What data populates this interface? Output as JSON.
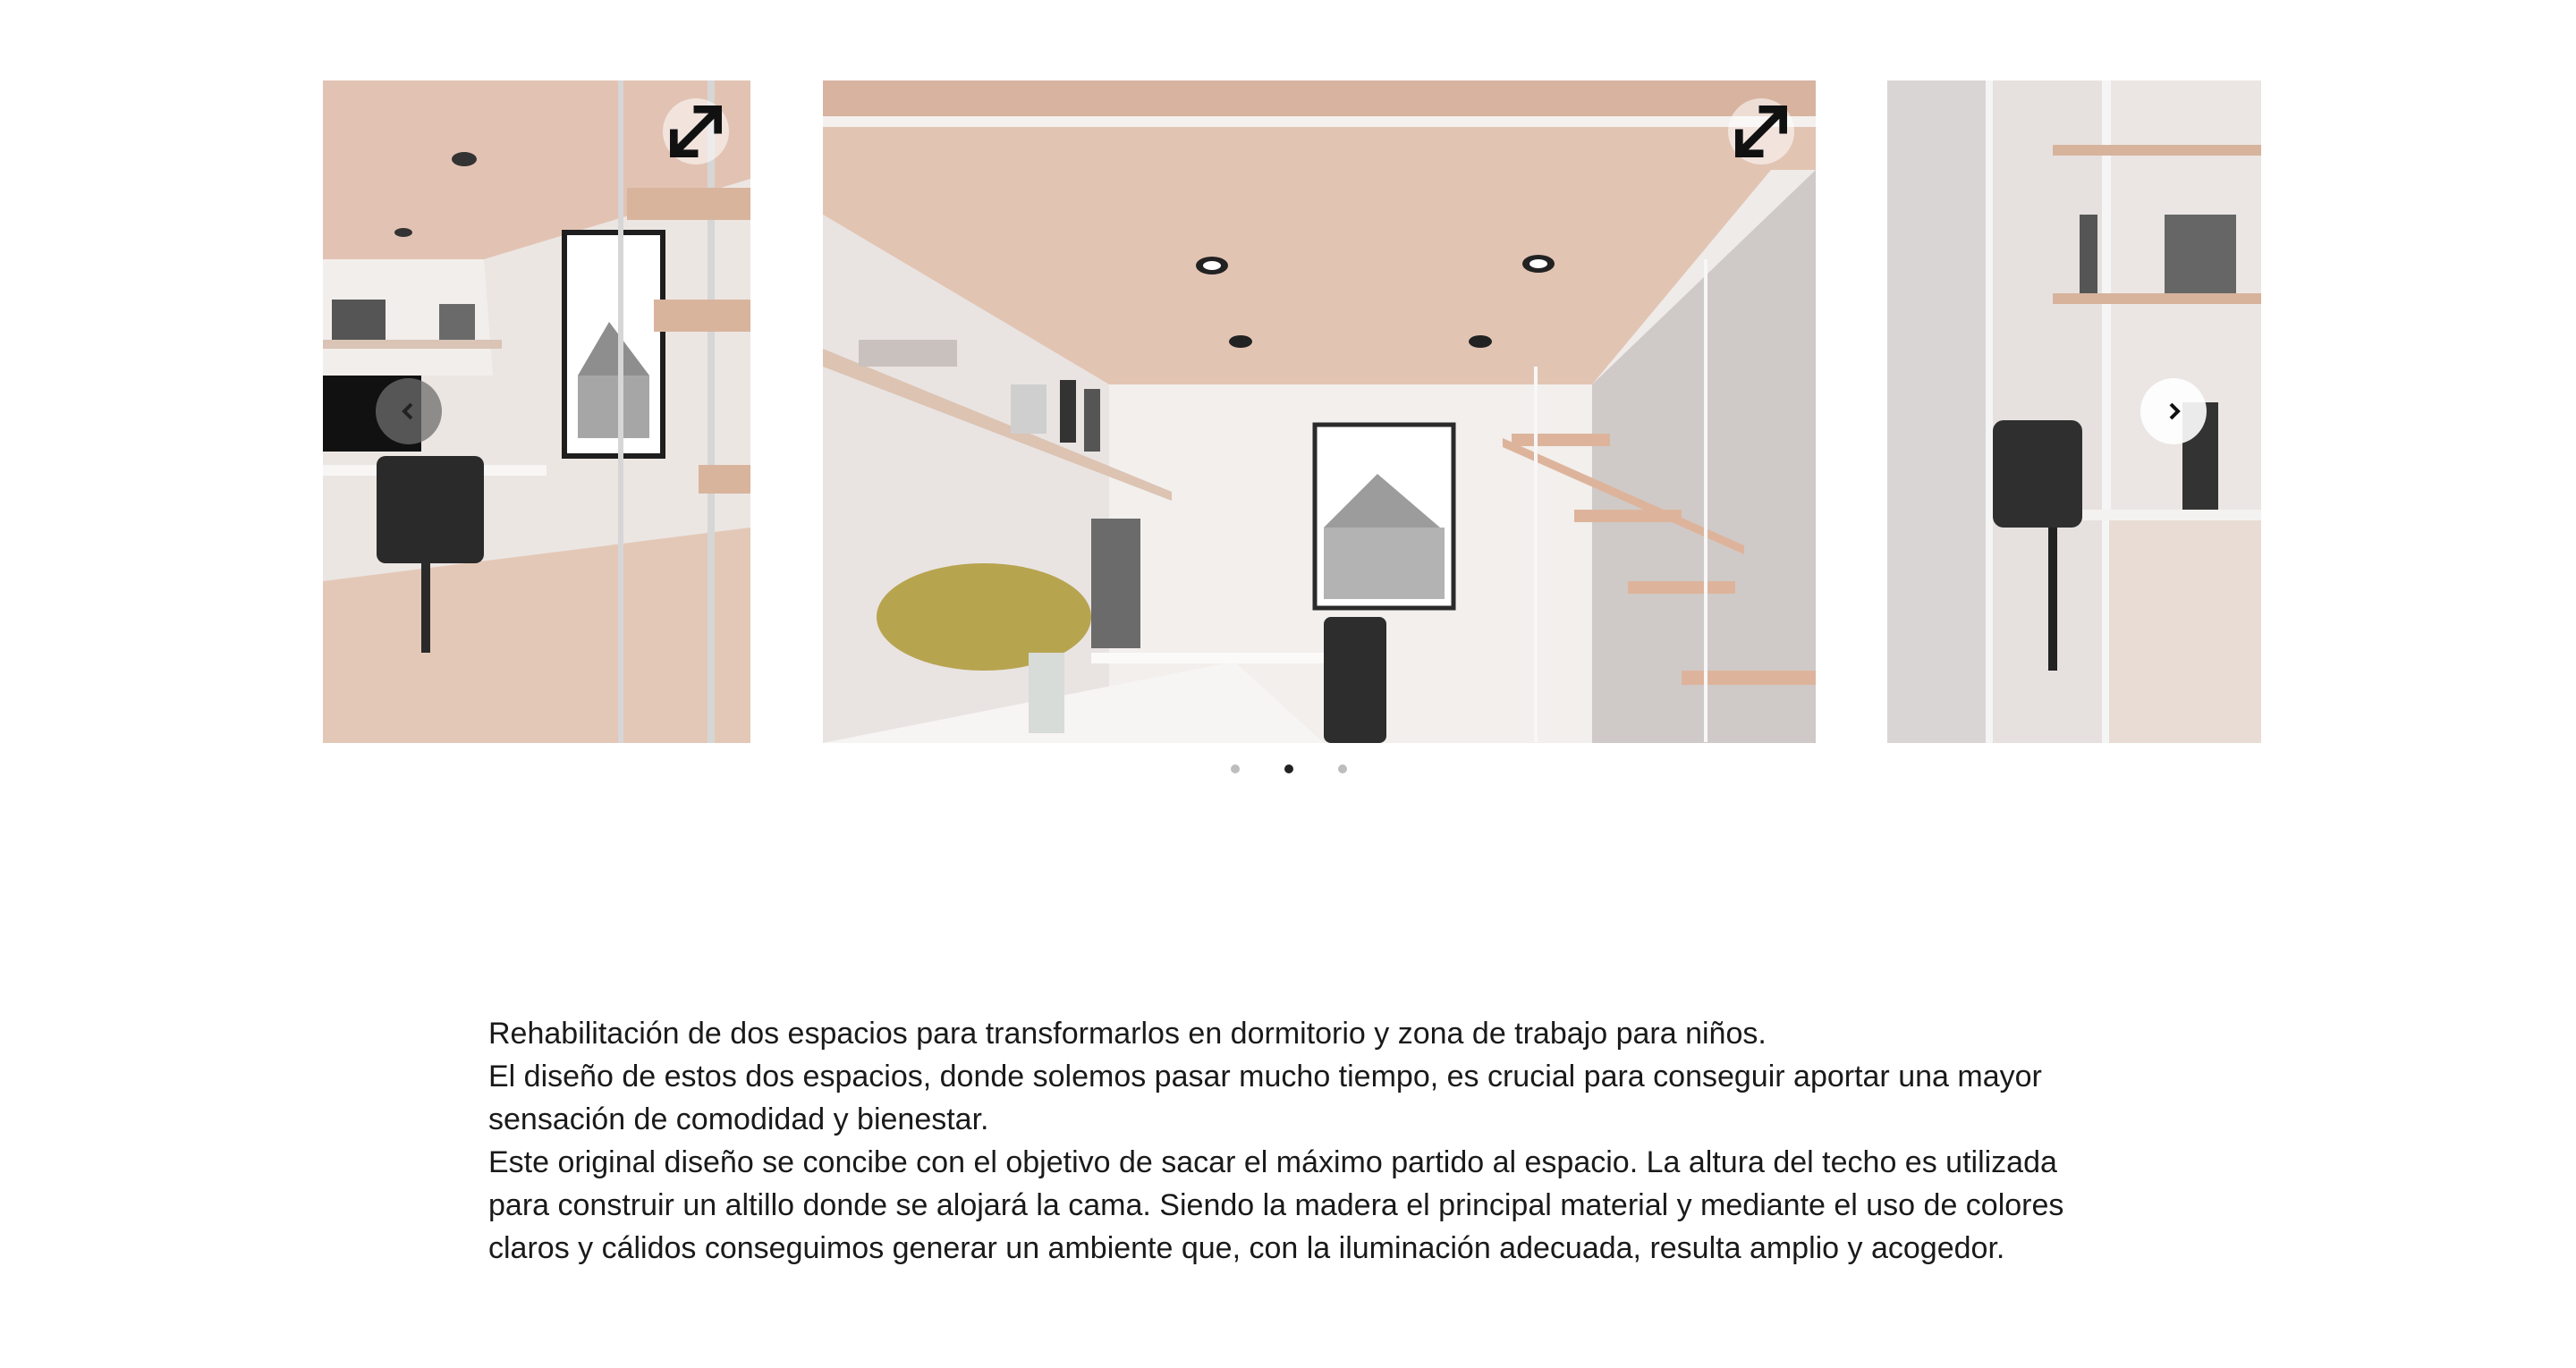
{
  "carousel": {
    "slides": [
      {
        "name": "slide-left",
        "visible": "partial"
      },
      {
        "name": "slide-main",
        "visible": "full",
        "active": true
      },
      {
        "name": "slide-right",
        "visible": "partial"
      }
    ],
    "prev_icon": "chevron-left-icon",
    "next_icon": "chevron-right-icon",
    "expand_icon": "expand-icon",
    "dots": 3,
    "active_dot": 1
  },
  "description": {
    "paragraphs": [
      "Rehabilitación de dos espacios para transformarlos en dormitorio y zona de trabajo para niños.",
      "El diseño de estos dos espacios, donde solemos pasar mucho tiempo, es crucial para conseguir aportar una mayor sensación de comodidad y bienestar.",
      "Este original diseño se concibe con el objetivo de sacar el máximo partido al espacio. La altura del techo es utilizada para construir un altillo donde se alojará la cama. Siendo la madera el principal material y mediante el uso de colores claros y cálidos conseguimos generar un ambiente que, con la iluminación adecuada, resulta amplio y acogedor."
    ]
  },
  "colors": {
    "wood": "#e0bfae",
    "wall": "#efeae8",
    "text": "#1a1a1a",
    "dot_active": "#222222",
    "dot_inactive": "#bdbdbd"
  }
}
